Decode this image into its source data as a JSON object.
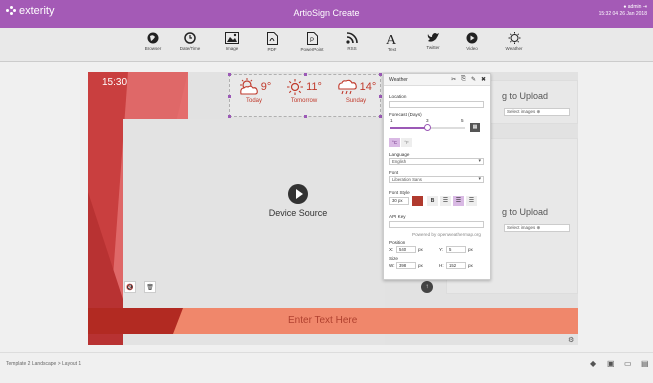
{
  "app": {
    "logo_text": "exterity",
    "title": "ArtioSign Create",
    "user_name": "admin",
    "user_datetime": "15:32 04 26 Jan 2018"
  },
  "toolbar": {
    "items": [
      {
        "label": "Browser",
        "icon": "globe-icon"
      },
      {
        "label": "Date/Time",
        "icon": "clock-icon"
      },
      {
        "label": "Image",
        "icon": "image-icon"
      },
      {
        "label": "PDF",
        "icon": "pdf-icon"
      },
      {
        "label": "PowerPoint",
        "icon": "powerpoint-icon"
      },
      {
        "label": "RSS",
        "icon": "rss-icon"
      },
      {
        "label": "Text",
        "icon": "text-icon"
      },
      {
        "label": "Twitter",
        "icon": "twitter-icon"
      },
      {
        "label": "Video",
        "icon": "video-icon"
      },
      {
        "label": "Weather",
        "icon": "weather-icon"
      }
    ]
  },
  "canvas": {
    "clock": "15:30",
    "weather": [
      {
        "temp": "9°",
        "day": "Today"
      },
      {
        "temp": "11°",
        "day": "Tomorrow"
      },
      {
        "temp": "14°",
        "day": "Sunday"
      }
    ],
    "device_source_label": "Device Source",
    "upload_top_title": "g to Upload",
    "upload_top_placeholder": "Select images",
    "upload_bottom_title": "g to Upload",
    "upload_bottom_placeholder": "Select images",
    "text_banner": "Enter Text Here"
  },
  "properties": {
    "title": "Weather",
    "location_label": "Location",
    "location_value": "",
    "forecast_label": "Forecast (Days)",
    "forecast_min": "1",
    "forecast_mid": "3",
    "forecast_max": "5",
    "forecast_value": 3,
    "unit_c": "°C",
    "unit_f": "°F",
    "language_label": "Language",
    "language_value": "English",
    "font_label": "Font",
    "font_value": "Liberation Sans",
    "font_style_label": "Font Style",
    "font_size": "30",
    "font_size_unit": "px",
    "font_color": "#b03a2e",
    "bold_label": "B",
    "api_key_label": "API Key",
    "api_key_value": "",
    "powered_by": "Powered by openweathermap.org",
    "position_label": "Position",
    "pos_x_label": "X:",
    "pos_x": "540",
    "pos_y_label": "Y:",
    "pos_y": "5",
    "size_label": "Size",
    "size_w_label": "W:",
    "size_w": "398",
    "size_h_label": "H:",
    "size_h": "152",
    "px": "px"
  },
  "footer": {
    "breadcrumb": "Template 2 Landscape > Layout 1"
  },
  "colors": {
    "accent": "#a45ab6",
    "banner": "#f0876b",
    "banner_dark": "#b22a22",
    "weather_text": "#c0392b"
  }
}
